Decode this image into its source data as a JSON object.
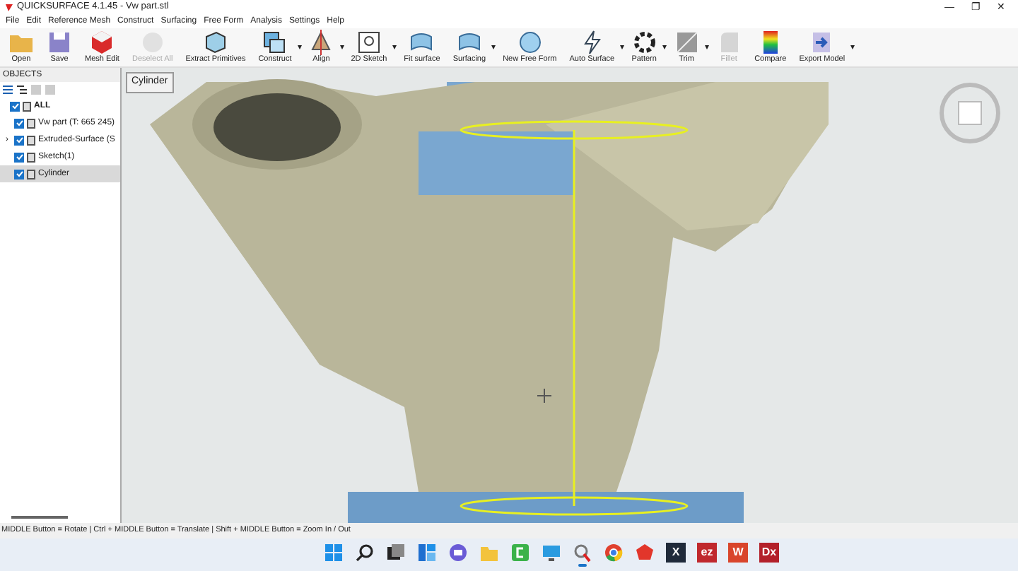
{
  "window": {
    "title": "QUICKSURFACE 4.1.45 - Vw part.stl",
    "controls": [
      "—",
      "❐",
      "✕"
    ]
  },
  "menu": [
    "File",
    "Edit",
    "Reference Mesh",
    "Construct",
    "Surfacing",
    "Free Form",
    "Analysis",
    "Settings",
    "Help"
  ],
  "toolbar": [
    {
      "label": "Open",
      "kind": "folder",
      "disabled": false
    },
    {
      "label": "Save",
      "kind": "save",
      "disabled": false
    },
    {
      "label": "Mesh Edit",
      "kind": "mesh",
      "disabled": false
    },
    {
      "label": "Deselect All",
      "kind": "circle",
      "disabled": true
    },
    {
      "label": "Extract Primitives",
      "kind": "cube",
      "disabled": false
    },
    {
      "label": "Construct",
      "kind": "construct",
      "disabled": false,
      "dropdown": "▾"
    },
    {
      "label": "Align",
      "kind": "align",
      "disabled": false,
      "dropdown": "▾"
    },
    {
      "label": "2D Sketch",
      "kind": "sketch",
      "disabled": false,
      "dropdown": "▾"
    },
    {
      "label": "Fit surface",
      "kind": "surface",
      "disabled": false
    },
    {
      "label": "Surfacing",
      "kind": "surface",
      "disabled": false,
      "dropdown": "▾"
    },
    {
      "label": "New Free Form",
      "kind": "freeform",
      "disabled": false
    },
    {
      "label": "Auto Surface",
      "kind": "bolt",
      "disabled": false,
      "dropdown": "▾"
    },
    {
      "label": "Pattern",
      "kind": "pattern",
      "disabled": false,
      "dropdown": "▾"
    },
    {
      "label": "Trim",
      "kind": "trim",
      "disabled": false,
      "dropdown": "▾"
    },
    {
      "label": "Fillet",
      "kind": "fillet",
      "disabled": true
    },
    {
      "label": "Compare",
      "kind": "compare",
      "disabled": false
    },
    {
      "label": "Export Model",
      "kind": "export",
      "disabled": false,
      "dropdown": "▾"
    }
  ],
  "objects_panel": {
    "title": "OBJECTS",
    "tree": [
      {
        "label": "ALL",
        "checked": true,
        "selected": false,
        "children": [
          {
            "label": "Vw part (T: 665 245)",
            "checked": true,
            "selected": false
          },
          {
            "label": "Extruded-Surface (S",
            "checked": true,
            "selected": false,
            "expander": "›"
          },
          {
            "label": "Sketch(1)",
            "checked": true,
            "selected": false
          },
          {
            "label": "Cylinder",
            "checked": true,
            "selected": true
          }
        ]
      }
    ]
  },
  "viewport": {
    "selection_label": "Cylinder"
  },
  "status_bar": "MIDDLE Button = Rotate | Ctrl + MIDDLE Button = Translate | Shift + MIDDLE Button = Zoom In / Out",
  "taskbar": [
    {
      "kind": "start",
      "active": false
    },
    {
      "kind": "search",
      "active": false
    },
    {
      "kind": "tasks",
      "active": false
    },
    {
      "kind": "widgets",
      "active": false
    },
    {
      "kind": "chat",
      "active": false
    },
    {
      "kind": "files",
      "active": false
    },
    {
      "kind": "green",
      "active": false
    },
    {
      "kind": "monitor",
      "active": false
    },
    {
      "kind": "qs",
      "active": true
    },
    {
      "kind": "chrome",
      "active": false
    },
    {
      "kind": "red",
      "active": false
    },
    {
      "kind": "letter",
      "label": "X",
      "color": "#1f2a3a"
    },
    {
      "kind": "letter",
      "label": "ez",
      "color": "#c0282d"
    },
    {
      "kind": "letter",
      "label": "W",
      "color": "#d9452b"
    },
    {
      "kind": "letter",
      "label": "Dx",
      "color": "#b3202a"
    }
  ]
}
